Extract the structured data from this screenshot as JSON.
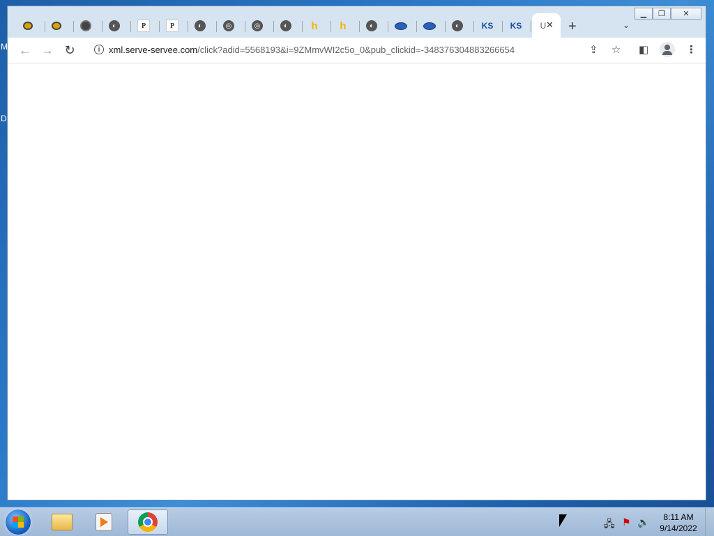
{
  "desktop": {
    "fragments": [
      "M",
      "D"
    ]
  },
  "window": {
    "caption_buttons": [
      "minimize-icon",
      "restore-icon",
      "close-icon"
    ]
  },
  "tabs": [
    {
      "icon": "bee-icon",
      "symbol": ""
    },
    {
      "icon": "bee-icon",
      "symbol": ""
    },
    {
      "icon": "chrome-icon",
      "symbol": ""
    },
    {
      "icon": "globe-icon",
      "symbol": "◐"
    },
    {
      "icon": "p-icon",
      "symbol": "P"
    },
    {
      "icon": "p-icon",
      "symbol": "P"
    },
    {
      "icon": "globe-icon",
      "symbol": "◐"
    },
    {
      "icon": "globe-icon",
      "symbol": "◎"
    },
    {
      "icon": "globe-icon",
      "symbol": "◎"
    },
    {
      "icon": "globe-icon",
      "symbol": "◐"
    },
    {
      "icon": "h-icon",
      "symbol": "h"
    },
    {
      "icon": "h-icon",
      "symbol": "h"
    },
    {
      "icon": "globe-icon",
      "symbol": "◐"
    },
    {
      "icon": "oval-icon",
      "symbol": ""
    },
    {
      "icon": "oval-icon",
      "symbol": ""
    },
    {
      "icon": "globe-icon",
      "symbol": "◐"
    },
    {
      "icon": "ks-icon",
      "symbol": "KS"
    },
    {
      "icon": "ks-icon",
      "symbol": "KS"
    },
    {
      "icon": "active-tab",
      "symbol": "U",
      "active": true
    }
  ],
  "tab_close_symbol": "✕",
  "newtab_symbol": "+",
  "tabsearch_symbol": "⌄",
  "toolbar": {
    "back": "←",
    "forward": "→",
    "reload": "↻",
    "url_host": "xml.serve-servee.com",
    "url_path": "/click?adid=5568193&i=9ZMmvWI2c5o_0&pub_clickid=-348376304883266654",
    "share_icon": "⇪",
    "star_icon": "☆",
    "sidepanel_icon": "◧",
    "menu_icon": "⋮"
  },
  "taskbar": {
    "apps": [
      "windows-explorer",
      "media-player",
      "google-chrome"
    ],
    "tray_icons": [
      "network-icon",
      "action-center-icon",
      "volume-icon"
    ],
    "tray_symbols": [
      "🖧",
      "⚑",
      "🔊"
    ],
    "time": "8:11 AM",
    "date": "9/14/2022"
  }
}
